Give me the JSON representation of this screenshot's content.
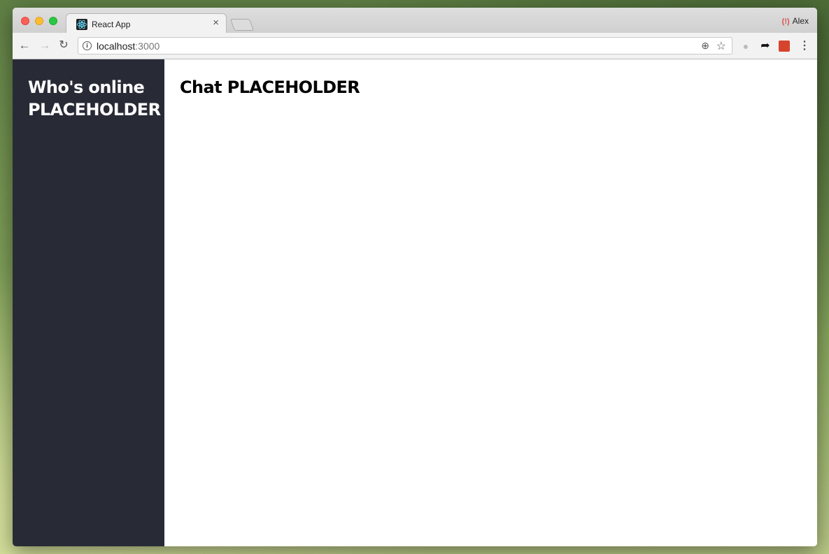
{
  "browser": {
    "tab_title": "React App",
    "tab_close": "×",
    "profile_name": "Alex",
    "url_host": "localhost",
    "url_port": ":3000"
  },
  "app": {
    "sidebar_heading_line1": "Who's online",
    "sidebar_heading_line2": "PLACEHOLDER",
    "chat_heading": "Chat PLACEHOLDER"
  },
  "colors": {
    "sidebar_bg": "#282b36",
    "main_bg": "#ffffff"
  }
}
